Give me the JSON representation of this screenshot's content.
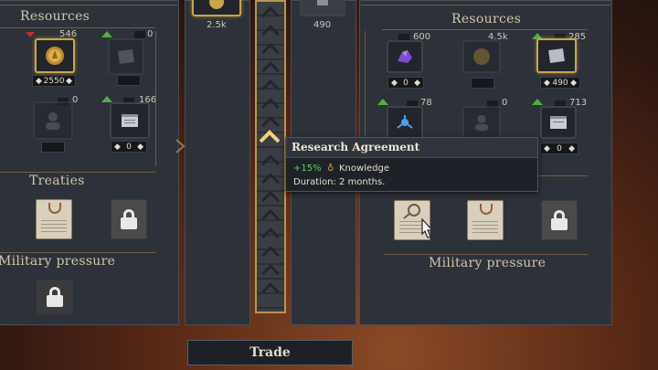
{
  "left_panel": {
    "resources_title": "Resources",
    "top_row": {
      "slot1_count": "546",
      "slot1_value": "2550",
      "slot2_count": "0"
    },
    "mid_row": {
      "slot1_count": "0",
      "slot2_count": "166",
      "slot2_value": "0"
    },
    "treaties_title": "Treaties",
    "military_title": "Military pressure"
  },
  "center": {
    "left_amount": "2.5k",
    "right_amount": "490"
  },
  "right_panel": {
    "resources_title": "Resources",
    "row1": {
      "slot1_count": "600",
      "slot1_value": "0",
      "slot2_count": "4.5k",
      "slot3_count": "285",
      "slot3_value": "490"
    },
    "row2": {
      "slot1_count": "78",
      "slot2_count": "0",
      "slot3_count": "713",
      "slot3_value": "0"
    },
    "military_title": "Military pressure"
  },
  "tooltip": {
    "title": "Research Agreement",
    "bonus": "+15%",
    "bonus_target": "Knowledge",
    "duration": "Duration: 2 months."
  },
  "trade_button": "Trade",
  "colors": {
    "gold": "#c9a646",
    "green_up": "#4fb03f",
    "red_down": "#c0302a",
    "panel": "#2d3139"
  }
}
